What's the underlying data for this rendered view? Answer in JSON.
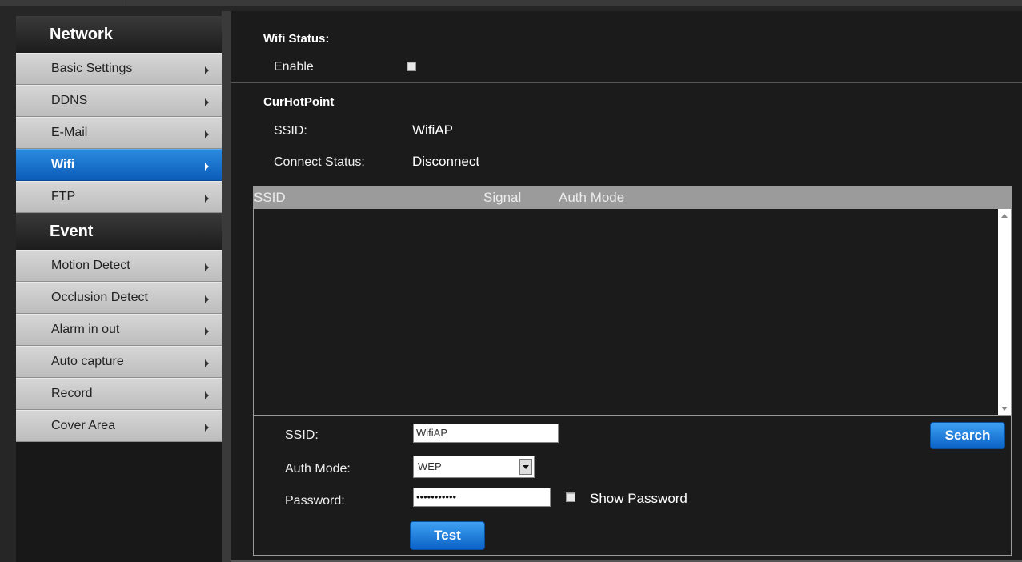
{
  "sidebar": {
    "sections": [
      {
        "title": "Network",
        "items": [
          {
            "label": "Basic Settings",
            "active": false
          },
          {
            "label": "DDNS",
            "active": false
          },
          {
            "label": "E-Mail",
            "active": false
          },
          {
            "label": "Wifi",
            "active": true
          },
          {
            "label": "FTP",
            "active": false
          }
        ]
      },
      {
        "title": "Event",
        "items": [
          {
            "label": "Motion Detect",
            "active": false
          },
          {
            "label": "Occlusion Detect",
            "active": false
          },
          {
            "label": "Alarm in out",
            "active": false
          },
          {
            "label": "Auto capture",
            "active": false
          },
          {
            "label": "Record",
            "active": false
          },
          {
            "label": "Cover Area",
            "active": false
          }
        ]
      }
    ]
  },
  "wifi_status": {
    "title": "Wifi Status:",
    "enable_label": "Enable",
    "enabled": false
  },
  "cur_hot_point": {
    "title": "CurHotPoint",
    "ssid_label": "SSID:",
    "ssid_value": "WifiAP",
    "connect_status_label": "Connect Status:",
    "connect_status_value": "Disconnect"
  },
  "network_table": {
    "columns": [
      "SSID",
      "Signal",
      "Auth Mode"
    ],
    "rows": []
  },
  "form": {
    "ssid_label": "SSID:",
    "ssid_value": "WifiAP",
    "auth_mode_label": "Auth Mode:",
    "auth_mode_value": "WEP",
    "password_label": "Password:",
    "password_value": "•••••••••••",
    "show_password_label": "Show Password",
    "show_password_checked": false,
    "search_button": "Search",
    "test_button": "Test"
  },
  "colors": {
    "active_item": "#0b5cb8",
    "button_blue": "#1f7fdc",
    "background": "#1b1b1b"
  }
}
